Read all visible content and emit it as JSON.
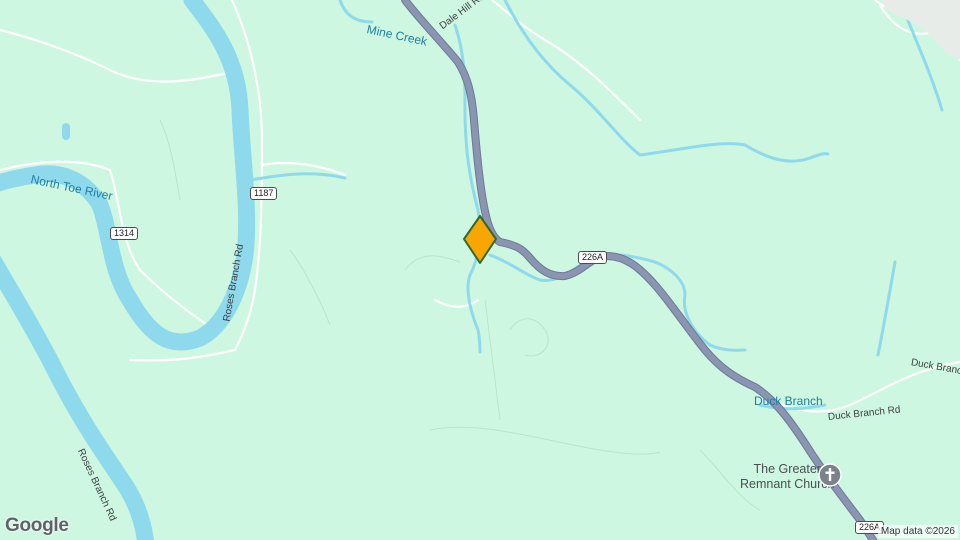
{
  "map": {
    "water_labels": {
      "mine_creek": "Mine Creek",
      "north_toe_river": "North Toe River",
      "duck_branch": "Duck Branch"
    },
    "road_labels": {
      "dale_hill_rd": "Dale Hill Rd",
      "roses_branch_rd_upper": "Roses Branch Rd",
      "roses_branch_rd_lower": "Roses Branch Rd",
      "duck_branch_rd_1": "Duck Branch Rd",
      "duck_branch_rd_2": "Duck Branch"
    },
    "shields": {
      "r1187": "1187",
      "r1314": "1314",
      "r226a_mid": "226A",
      "r226a_bottom": "226A"
    },
    "poi": {
      "name_line1": "The Greater",
      "name_line2": "Remnant Church",
      "icon": "church-cross-icon"
    },
    "marker": {
      "icon": "location-marker-icon",
      "color": "#f9a602"
    },
    "attribution": "Map data ©2026",
    "logo": "Google",
    "colors": {
      "land": "#cdf7e0",
      "water": "#8fd9ec",
      "highway": "#8a95b2",
      "minor_road": "#ffffff"
    }
  }
}
